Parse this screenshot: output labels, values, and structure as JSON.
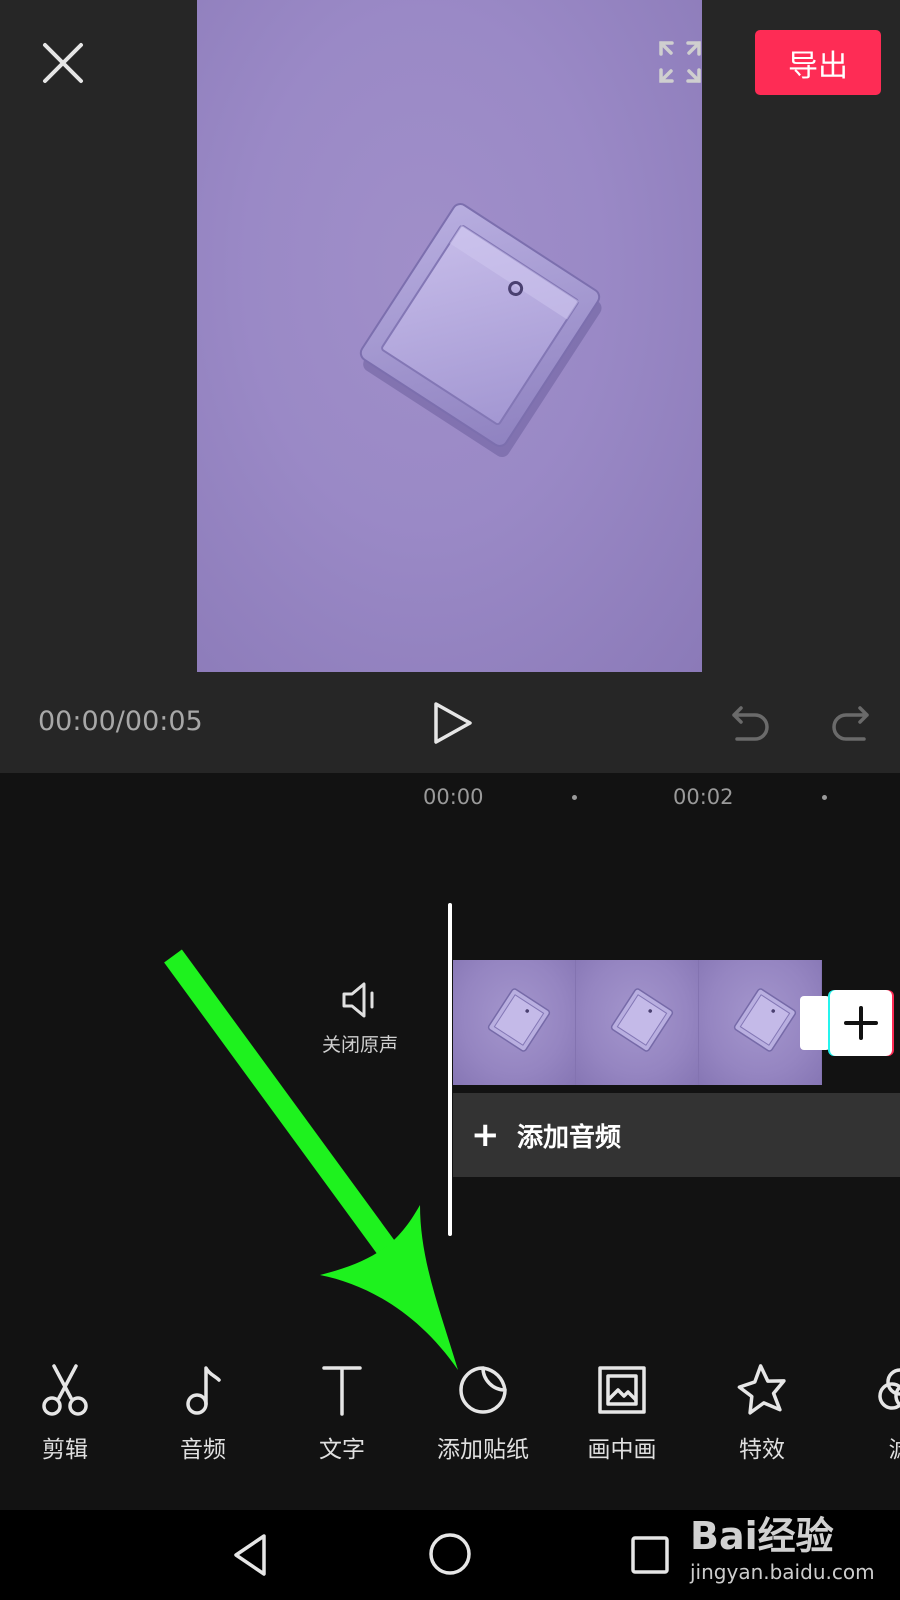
{
  "top_bar": {
    "export_label": "导出",
    "icons": [
      "close-icon",
      "fullscreen-icon"
    ],
    "accent_color": "#fe2c55"
  },
  "player": {
    "time_readout": "00:00/00:05",
    "icons": [
      "play-icon",
      "undo-icon",
      "redo-icon"
    ]
  },
  "timeline": {
    "ruler_labels": [
      "00:00",
      "00:02"
    ],
    "mute_label": "关闭原声",
    "add_audio_label": "添加音频",
    "add_audio_plus": "+"
  },
  "toolbar": {
    "items": [
      {
        "label": "剪辑",
        "icon": "scissors-icon"
      },
      {
        "label": "音频",
        "icon": "music-note-icon"
      },
      {
        "label": "文字",
        "icon": "text-icon"
      },
      {
        "label": "添加贴纸",
        "icon": "sticker-icon"
      },
      {
        "label": "画中画",
        "icon": "picture-in-picture-icon"
      },
      {
        "label": "特效",
        "icon": "star-effect-icon"
      },
      {
        "label": "滤",
        "icon": "filter-icon"
      }
    ]
  },
  "navbar": {
    "icons": [
      "back-triangle-icon",
      "home-circle-icon",
      "recent-square-icon"
    ]
  },
  "watermark": {
    "brand": "Bai经验",
    "url": "jingyan.baidu.com"
  },
  "annotation": {
    "arrow_color": "#1ef21e"
  }
}
